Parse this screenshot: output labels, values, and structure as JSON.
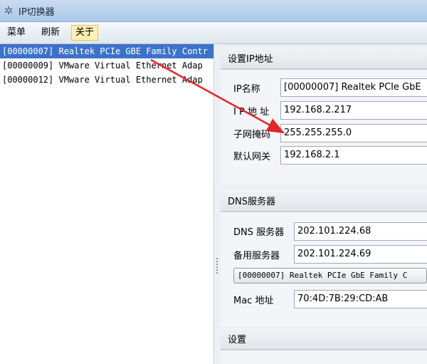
{
  "window": {
    "title": "IP切换器",
    "icon": "gear-icon"
  },
  "menu": {
    "items": [
      "菜单",
      "刷新",
      "关于"
    ],
    "active_index": 2
  },
  "adapters": [
    "[00000007] Realtek PCIe GBE Family Contr",
    "[00000009] VMware Virtual Ethernet Adap",
    "[00000012] VMware Virtual Ethernet Adap"
  ],
  "ip_section": {
    "header": "设置IP地址",
    "fields": [
      {
        "label": "IP名称",
        "value": "[00000007] Realtek PCIe GbE"
      },
      {
        "label": "I P 地 址",
        "value": "192.168.2.217"
      },
      {
        "label": "子网掩码",
        "value": "255.255.255.0"
      },
      {
        "label": "默认网关",
        "value": "192.168.2.1"
      }
    ]
  },
  "dns_section": {
    "header": "DNS服务器",
    "dns_label": "DNS 服务器",
    "dns_value": "202.101.224.68",
    "backup_label": "备用服务器",
    "backup_value": "202.101.224.69",
    "adapter_combo": "[00000007] Realtek PCIe GbE Family C",
    "mac_label": "Mac 地址",
    "mac_value": "70:4D:7B:29:CD:AB"
  },
  "settings_section": {
    "header": "设置"
  },
  "annotation": {
    "color": "#e0282a"
  },
  "colors": {
    "selection": "#3c73c8",
    "title_bar": "#aac7ea",
    "menu_active": "#fff1b5"
  }
}
